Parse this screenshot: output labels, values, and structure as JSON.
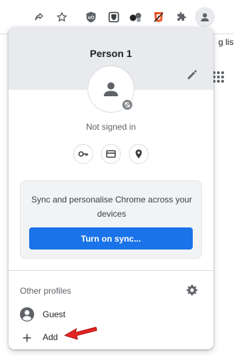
{
  "toolbar": {
    "icons": [
      "share-icon",
      "bookmark-star-icon",
      "ublock-icon",
      "bitwarden-icon",
      "extension-dots-icon",
      "html5-icon",
      "extensions-puzzle-icon",
      "profile-avatar-icon"
    ],
    "ublock_badge": "uO"
  },
  "background_page": {
    "partial_text": "g list"
  },
  "profile_menu": {
    "name": "Person 1",
    "status": "Not signed in",
    "quick_actions": [
      "passwords-key-icon",
      "payment-card-icon",
      "addresses-pin-icon"
    ],
    "sync": {
      "message": "Sync and personalise Chrome across your devices",
      "button_label": "Turn on sync..."
    },
    "other_profiles": {
      "heading": "Other profiles",
      "items": [
        {
          "label": "Guest",
          "icon": "guest-person-icon"
        },
        {
          "label": "Add",
          "icon": "plus-icon"
        }
      ]
    }
  },
  "colors": {
    "accent": "#1a73e8",
    "header_band": "#e8eaed",
    "sync_card": "#f1f3f4",
    "annotation_arrow": "#e52421"
  }
}
